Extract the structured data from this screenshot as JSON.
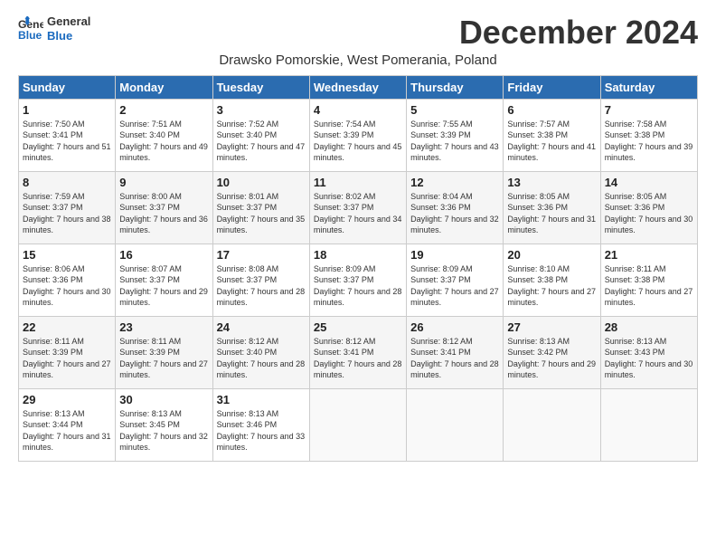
{
  "logo": {
    "line1": "General",
    "line2": "Blue"
  },
  "title": "December 2024",
  "subtitle": "Drawsko Pomorskie, West Pomerania, Poland",
  "header": {
    "days": [
      "Sunday",
      "Monday",
      "Tuesday",
      "Wednesday",
      "Thursday",
      "Friday",
      "Saturday"
    ]
  },
  "weeks": [
    [
      {
        "day": "1",
        "sunrise": "7:50 AM",
        "sunset": "3:41 PM",
        "daylight": "7 hours and 51 minutes."
      },
      {
        "day": "2",
        "sunrise": "7:51 AM",
        "sunset": "3:40 PM",
        "daylight": "7 hours and 49 minutes."
      },
      {
        "day": "3",
        "sunrise": "7:52 AM",
        "sunset": "3:40 PM",
        "daylight": "7 hours and 47 minutes."
      },
      {
        "day": "4",
        "sunrise": "7:54 AM",
        "sunset": "3:39 PM",
        "daylight": "7 hours and 45 minutes."
      },
      {
        "day": "5",
        "sunrise": "7:55 AM",
        "sunset": "3:39 PM",
        "daylight": "7 hours and 43 minutes."
      },
      {
        "day": "6",
        "sunrise": "7:57 AM",
        "sunset": "3:38 PM",
        "daylight": "7 hours and 41 minutes."
      },
      {
        "day": "7",
        "sunrise": "7:58 AM",
        "sunset": "3:38 PM",
        "daylight": "7 hours and 39 minutes."
      }
    ],
    [
      {
        "day": "8",
        "sunrise": "7:59 AM",
        "sunset": "3:37 PM",
        "daylight": "7 hours and 38 minutes."
      },
      {
        "day": "9",
        "sunrise": "8:00 AM",
        "sunset": "3:37 PM",
        "daylight": "7 hours and 36 minutes."
      },
      {
        "day": "10",
        "sunrise": "8:01 AM",
        "sunset": "3:37 PM",
        "daylight": "7 hours and 35 minutes."
      },
      {
        "day": "11",
        "sunrise": "8:02 AM",
        "sunset": "3:37 PM",
        "daylight": "7 hours and 34 minutes."
      },
      {
        "day": "12",
        "sunrise": "8:04 AM",
        "sunset": "3:36 PM",
        "daylight": "7 hours and 32 minutes."
      },
      {
        "day": "13",
        "sunrise": "8:05 AM",
        "sunset": "3:36 PM",
        "daylight": "7 hours and 31 minutes."
      },
      {
        "day": "14",
        "sunrise": "8:05 AM",
        "sunset": "3:36 PM",
        "daylight": "7 hours and 30 minutes."
      }
    ],
    [
      {
        "day": "15",
        "sunrise": "8:06 AM",
        "sunset": "3:36 PM",
        "daylight": "7 hours and 30 minutes."
      },
      {
        "day": "16",
        "sunrise": "8:07 AM",
        "sunset": "3:37 PM",
        "daylight": "7 hours and 29 minutes."
      },
      {
        "day": "17",
        "sunrise": "8:08 AM",
        "sunset": "3:37 PM",
        "daylight": "7 hours and 28 minutes."
      },
      {
        "day": "18",
        "sunrise": "8:09 AM",
        "sunset": "3:37 PM",
        "daylight": "7 hours and 28 minutes."
      },
      {
        "day": "19",
        "sunrise": "8:09 AM",
        "sunset": "3:37 PM",
        "daylight": "7 hours and 27 minutes."
      },
      {
        "day": "20",
        "sunrise": "8:10 AM",
        "sunset": "3:38 PM",
        "daylight": "7 hours and 27 minutes."
      },
      {
        "day": "21",
        "sunrise": "8:11 AM",
        "sunset": "3:38 PM",
        "daylight": "7 hours and 27 minutes."
      }
    ],
    [
      {
        "day": "22",
        "sunrise": "8:11 AM",
        "sunset": "3:39 PM",
        "daylight": "7 hours and 27 minutes."
      },
      {
        "day": "23",
        "sunrise": "8:11 AM",
        "sunset": "3:39 PM",
        "daylight": "7 hours and 27 minutes."
      },
      {
        "day": "24",
        "sunrise": "8:12 AM",
        "sunset": "3:40 PM",
        "daylight": "7 hours and 28 minutes."
      },
      {
        "day": "25",
        "sunrise": "8:12 AM",
        "sunset": "3:41 PM",
        "daylight": "7 hours and 28 minutes."
      },
      {
        "day": "26",
        "sunrise": "8:12 AM",
        "sunset": "3:41 PM",
        "daylight": "7 hours and 28 minutes."
      },
      {
        "day": "27",
        "sunrise": "8:13 AM",
        "sunset": "3:42 PM",
        "daylight": "7 hours and 29 minutes."
      },
      {
        "day": "28",
        "sunrise": "8:13 AM",
        "sunset": "3:43 PM",
        "daylight": "7 hours and 30 minutes."
      }
    ],
    [
      {
        "day": "29",
        "sunrise": "8:13 AM",
        "sunset": "3:44 PM",
        "daylight": "7 hours and 31 minutes."
      },
      {
        "day": "30",
        "sunrise": "8:13 AM",
        "sunset": "3:45 PM",
        "daylight": "7 hours and 32 minutes."
      },
      {
        "day": "31",
        "sunrise": "8:13 AM",
        "sunset": "3:46 PM",
        "daylight": "7 hours and 33 minutes."
      },
      null,
      null,
      null,
      null
    ]
  ]
}
